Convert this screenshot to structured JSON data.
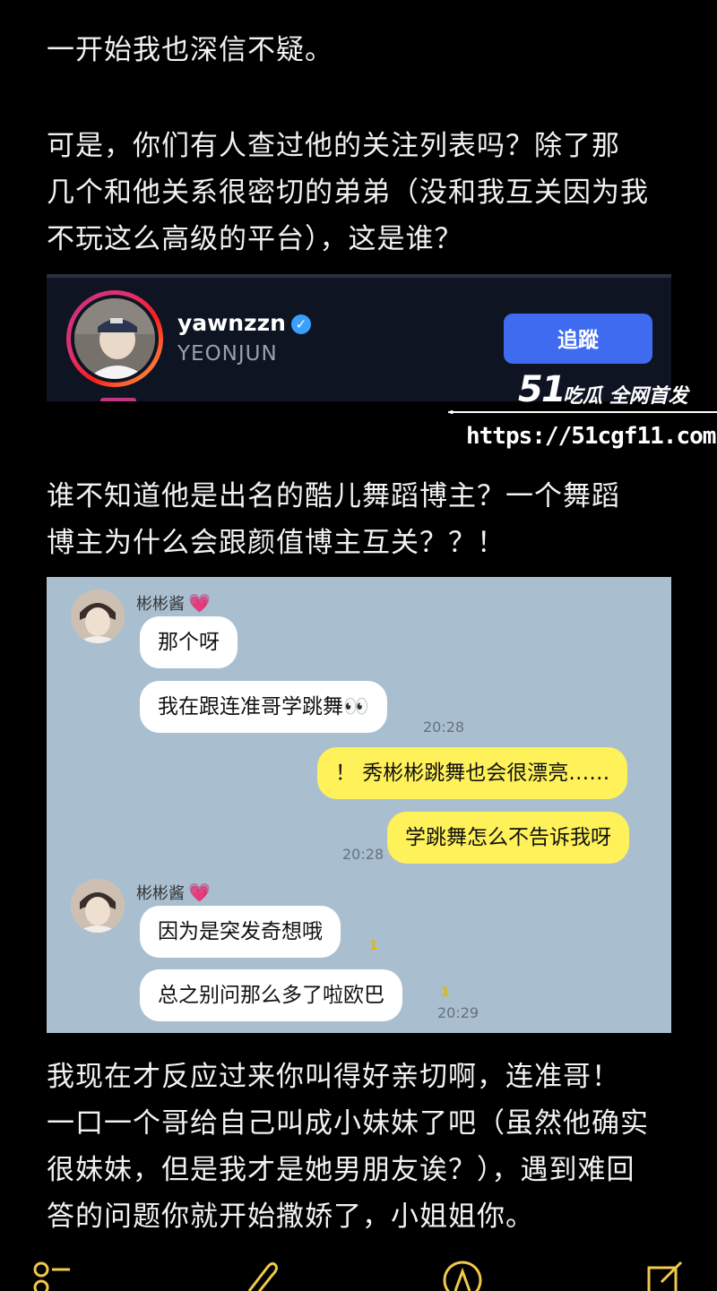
{
  "post": {
    "p1": "一开始我也深信不疑。",
    "p2": "可是，你们有人查过他的关注列表吗？除了那\n几个和他关系很密切的弟弟（没和我互关因为我\n不玩这么高级的平台），这是谁？",
    "p3": "谁不知道他是出名的酷儿舞蹈博主？一个舞蹈\n博主为什么会跟颜值博主互关？？！",
    "p4": "我现在才反应过来你叫得好亲切啊，连准哥！\n一口一个哥给自己叫成小妹妹了吧（虽然他确实\n很妹妹，但是我才是她男朋友诶？），遇到难回\n答的问题你就开始撒娇了，小姐姐你。"
  },
  "profile_card": {
    "handle": "yawnzzn",
    "verified_mark": "✓",
    "name": "YEONJUN",
    "follow_label": "追蹤"
  },
  "watermark": {
    "logo": "51",
    "tagline": "吃瓜 全网首发",
    "url": "https://51cgf11.com"
  },
  "chat": {
    "contact_name": "彬彬酱",
    "heart": "💗",
    "messages": [
      {
        "from": "them",
        "text": "那个呀"
      },
      {
        "from": "them",
        "text": "我在跟连准哥学跳舞👀",
        "time": "20:28"
      },
      {
        "from": "me",
        "text": "！ 秀彬彬跳舞也会很漂亮……"
      },
      {
        "from": "me",
        "text": "学跳舞怎么不告诉我呀",
        "time": "20:28"
      },
      {
        "from": "them",
        "text": "因为是突发奇想哦",
        "unread": "1"
      },
      {
        "from": "them",
        "text": "总之别问那么多了啦欧巴",
        "unread": "1",
        "time": "20:29"
      }
    ]
  },
  "toolbar": {
    "icons": [
      "checklist-icon",
      "attachment-icon",
      "pen-icon",
      "compose-icon"
    ]
  },
  "colors": {
    "background": "#000000",
    "follow_button": "#3e6bf0",
    "chat_background": "#a9bfd0",
    "outgoing_bubble": "#fff159",
    "toolbar_icon": "#f2c94c"
  }
}
